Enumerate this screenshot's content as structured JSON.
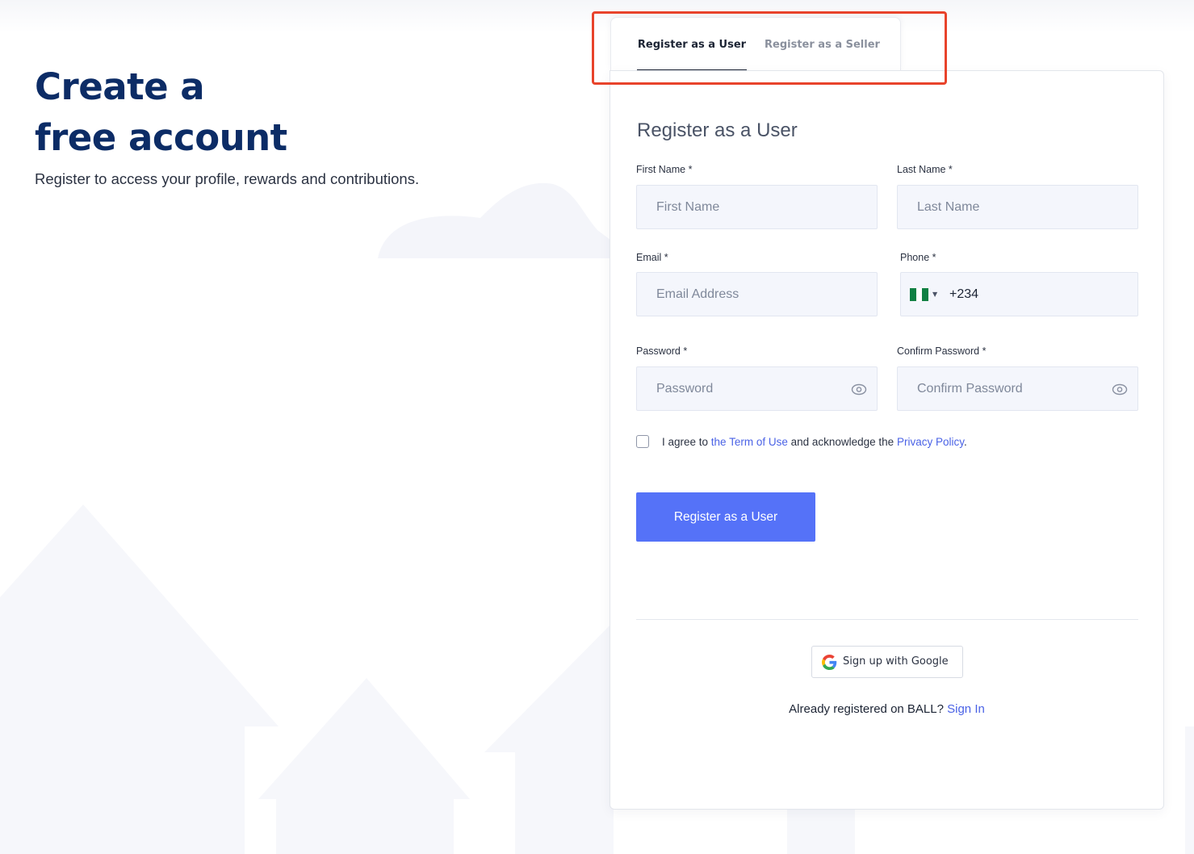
{
  "hero": {
    "title_line1": "Create a",
    "title_line2": "free account",
    "subtitle": "Register to access your profile, rewards and contributions."
  },
  "tabs": [
    {
      "label": "Register as a User",
      "active": true
    },
    {
      "label": "Register as a Seller",
      "active": false
    }
  ],
  "form": {
    "title": "Register as a User",
    "first_name": {
      "label": "First Name *",
      "placeholder": "First Name",
      "value": ""
    },
    "last_name": {
      "label": "Last Name *",
      "placeholder": "Last Name",
      "value": ""
    },
    "email": {
      "label": "Email *",
      "placeholder": "Email Address",
      "value": ""
    },
    "phone": {
      "label": "Phone *",
      "dial_code": "+234",
      "country_flag": "nigeria-flag-icon",
      "value": ""
    },
    "password": {
      "label": "Password *",
      "placeholder": "Password",
      "value": ""
    },
    "confirm_password": {
      "label": "Confirm Password *",
      "placeholder": "Confirm Password",
      "value": ""
    },
    "agree": {
      "checked": false,
      "prefix": "I agree to ",
      "terms_link": "the Term of Use",
      "middle": " and acknowledge the ",
      "privacy_link": "Privacy Policy",
      "suffix": "."
    },
    "submit_label": "Register as a User"
  },
  "social": {
    "google_label": "Sign up with Google"
  },
  "signin": {
    "prompt": "Already registered on BALL? ",
    "link": "Sign In"
  },
  "colors": {
    "accent": "#5572f8",
    "heading": "#0c2c66",
    "link": "#4a62e6",
    "highlight": "#e8432b"
  }
}
